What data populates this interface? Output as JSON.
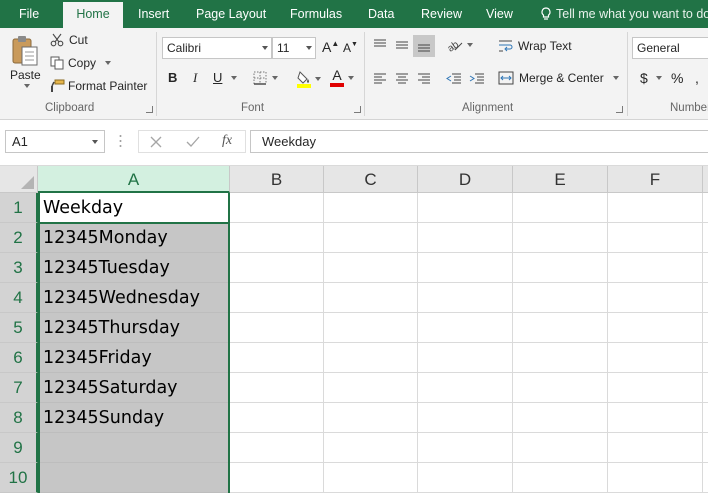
{
  "tabs": [
    {
      "label": "File"
    },
    {
      "label": "Home"
    },
    {
      "label": "Insert"
    },
    {
      "label": "Page Layout"
    },
    {
      "label": "Formulas"
    },
    {
      "label": "Data"
    },
    {
      "label": "Review"
    },
    {
      "label": "View"
    }
  ],
  "tell_me": "Tell me what you want to do",
  "ribbon": {
    "clipboard": {
      "paste": "Paste",
      "cut": "Cut",
      "copy": "Copy",
      "format_painter": "Format Painter",
      "group": "Clipboard"
    },
    "font": {
      "name": "Calibri",
      "size": "11",
      "group": "Font",
      "bold": "B",
      "italic": "I",
      "underline": "U",
      "grow": "A",
      "shrink": "A",
      "color": "A"
    },
    "alignment": {
      "wrap_text": "Wrap Text",
      "merge_center": "Merge & Center",
      "group": "Alignment"
    },
    "number": {
      "format": "General",
      "currency": "$",
      "percent": "%",
      "group": "Number"
    }
  },
  "formula_bar": {
    "name_box": "A1",
    "fx": "fx",
    "value": "Weekday"
  },
  "sheet": {
    "columns": [
      "A",
      "B",
      "C",
      "D",
      "E",
      "F"
    ],
    "rows": [
      "1",
      "2",
      "3",
      "4",
      "5",
      "6",
      "7",
      "8",
      "9",
      "10"
    ],
    "cells_a": [
      "Weekday",
      "12345Monday",
      "12345Tuesday",
      "12345Wednesday",
      "12345Thursday",
      "12345Friday",
      "12345Saturday",
      "12345Sunday",
      "",
      ""
    ]
  },
  "colors": {
    "accent": "#217346",
    "selection_fill": "#c6c6c6",
    "header_selected": "#d3f0e0"
  }
}
